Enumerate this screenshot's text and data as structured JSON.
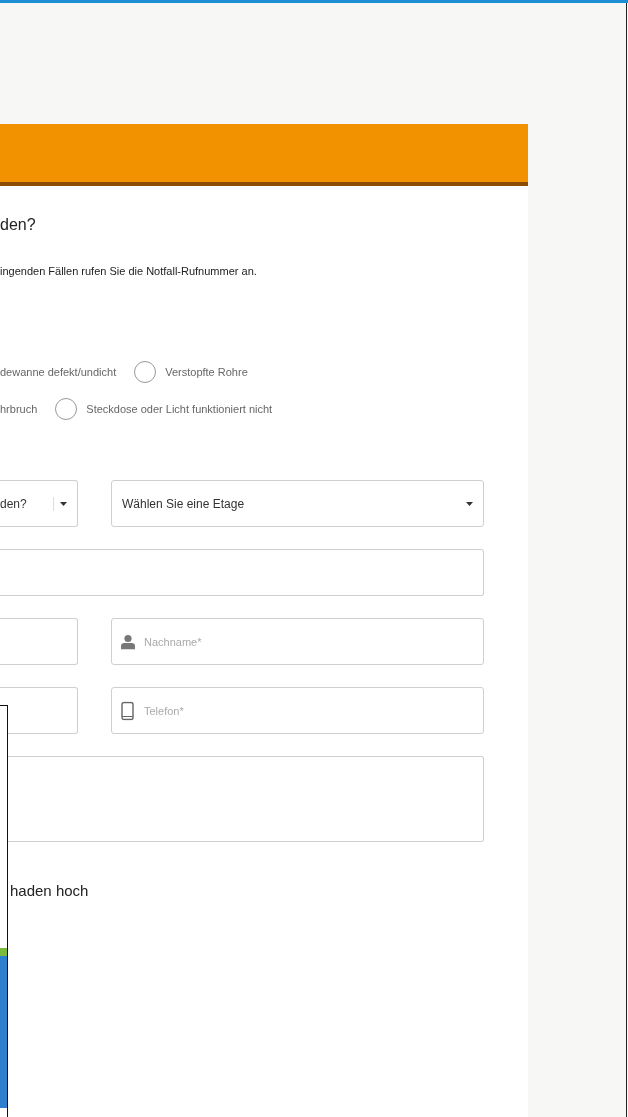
{
  "form": {
    "heading": "den?",
    "notice": "ingenden Fällen rufen Sie die Notfall-Rufnummer an.",
    "damage_options": [
      [
        {
          "kind": "clipped",
          "label": "dewanne defekt/undicht"
        },
        {
          "kind": "radio",
          "label": "Verstopfte Rohre",
          "selected": false
        }
      ],
      [
        {
          "kind": "clipped",
          "label": "hrbruch"
        },
        {
          "kind": "radio",
          "label": "Steckdose oder Licht funktioniert nicht",
          "selected": false
        }
      ]
    ],
    "selects": [
      {
        "value": "den?"
      },
      {
        "value": "Wählen Sie eine Etage"
      }
    ],
    "fields": [
      [
        {
          "kind": "text"
        }
      ],
      [
        {
          "kind": "text"
        },
        {
          "kind": "person",
          "placeholder": "Nachname*"
        }
      ],
      [
        {
          "kind": "text"
        },
        {
          "kind": "phone",
          "placeholder": "Telefon*"
        }
      ],
      [
        {
          "kind": "textarea"
        }
      ]
    ],
    "upload_heading": "haden hoch"
  }
}
